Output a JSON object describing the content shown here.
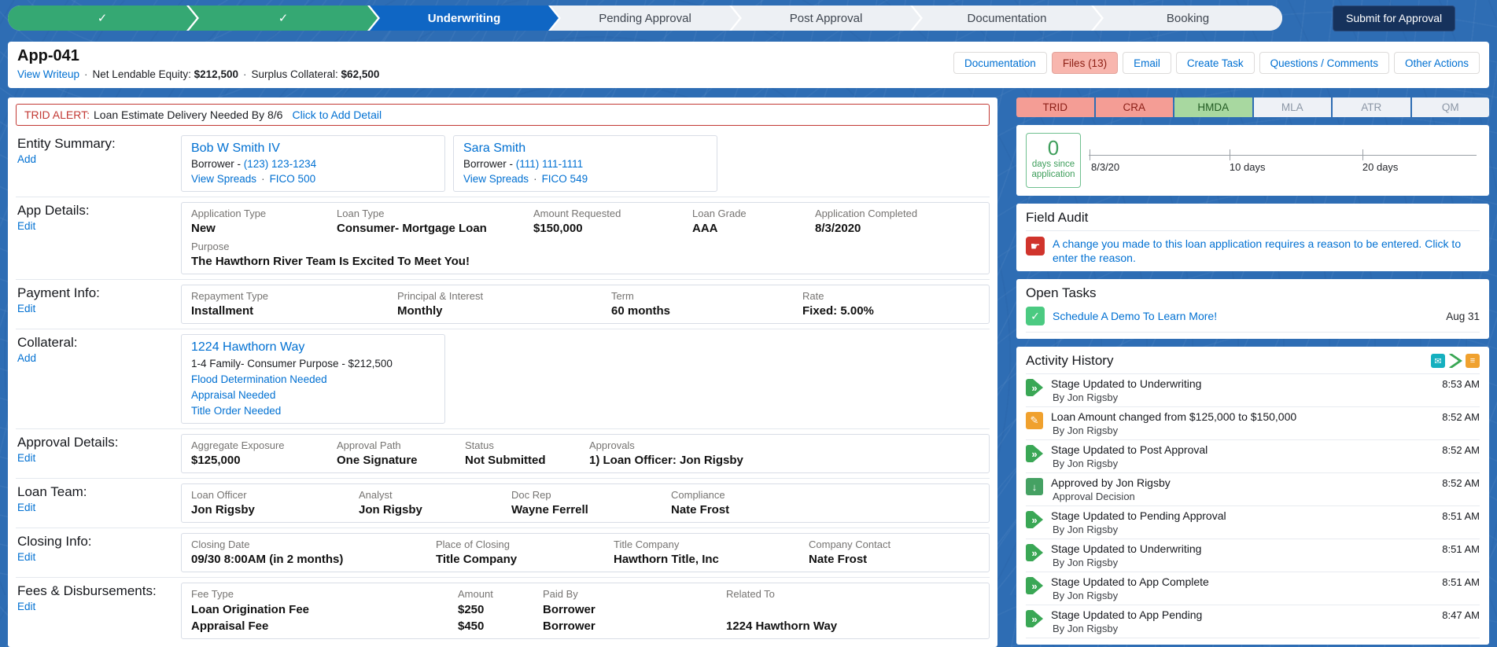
{
  "misc": {
    "dot": "·"
  },
  "icons": {
    "check": "✓",
    "chevrons": "»",
    "mail": "✉",
    "edit": "✎",
    "approve": "↓",
    "list": "≡",
    "hand": "☛",
    "task": "✓"
  },
  "path": {
    "stages": [
      {
        "label": "",
        "state": "complete"
      },
      {
        "label": "",
        "state": "complete"
      },
      {
        "label": "Underwriting",
        "state": "current"
      },
      {
        "label": "Pending Approval",
        "state": "incomplete"
      },
      {
        "label": "Post Approval",
        "state": "incomplete"
      },
      {
        "label": "Documentation",
        "state": "incomplete"
      },
      {
        "label": "Booking",
        "state": "incomplete"
      }
    ],
    "submit_button": "Submit for Approval"
  },
  "header": {
    "title": "App-041",
    "view_writeup": "View Writeup",
    "net_lendable_label": "Net Lendable Equity:",
    "net_lendable_value": "$212,500",
    "surplus_label": "Surplus Collateral:",
    "surplus_value": "$62,500",
    "actions": [
      {
        "label": "Documentation",
        "highlight": false
      },
      {
        "label": "Files (13)",
        "highlight": true
      },
      {
        "label": "Email",
        "highlight": false
      },
      {
        "label": "Create Task",
        "highlight": false
      },
      {
        "label": "Questions / Comments",
        "highlight": false
      },
      {
        "label": "Other Actions",
        "highlight": false
      }
    ]
  },
  "alert": {
    "tag": "TRID ALERT:",
    "message": "Loan Estimate Delivery Needed By 8/6",
    "action": "Click to Add Detail"
  },
  "sections": {
    "entity": {
      "title": "Entity Summary:",
      "action": "Add",
      "borrowers": [
        {
          "name": "Bob W Smith IV",
          "role": "Borrower -",
          "phone": "(123) 123-1234",
          "link1": "View Spreads",
          "link2": "FICO 500"
        },
        {
          "name": "Sara Smith",
          "role": "Borrower -",
          "phone": "(111) 111-1111",
          "link1": "View Spreads",
          "link2": "FICO 549"
        }
      ]
    },
    "app_details": {
      "title": "App Details:",
      "action": "Edit",
      "fields": [
        {
          "label": "Application Type",
          "value": "New"
        },
        {
          "label": "Loan Type",
          "value": "Consumer- Mortgage Loan"
        },
        {
          "label": "Amount Requested",
          "value": "$150,000"
        },
        {
          "label": "Loan Grade",
          "value": "AAA"
        },
        {
          "label": "Application Completed",
          "value": "8/3/2020"
        }
      ],
      "purpose": {
        "label": "Purpose",
        "value": "The Hawthorn River Team Is Excited To Meet You!"
      }
    },
    "payment": {
      "title": "Payment Info:",
      "action": "Edit",
      "fields": [
        {
          "label": "Repayment Type",
          "value": "Installment"
        },
        {
          "label": "Principal & Interest",
          "value": "Monthly"
        },
        {
          "label": "Term",
          "value": "60 months"
        },
        {
          "label": "Rate",
          "value": "Fixed: 5.00%"
        }
      ]
    },
    "collateral": {
      "title": "Collateral:",
      "action": "Add",
      "address": "1224 Hawthorn Way",
      "description": "1-4 Family- Consumer Purpose - $212,500",
      "links": [
        "Flood Determination Needed",
        "Appraisal Needed",
        "Title Order Needed"
      ]
    },
    "approval": {
      "title": "Approval Details:",
      "action": "Edit",
      "fields": [
        {
          "label": "Aggregate Exposure",
          "value": "$125,000"
        },
        {
          "label": "Approval Path",
          "value": "One Signature"
        },
        {
          "label": "Status",
          "value": "Not Submitted"
        },
        {
          "label": "Approvals",
          "value": "1) Loan Officer: Jon Rigsby"
        }
      ]
    },
    "loan_team": {
      "title": "Loan Team:",
      "action": "Edit",
      "fields": [
        {
          "label": "Loan Officer",
          "value": "Jon Rigsby"
        },
        {
          "label": "Analyst",
          "value": "Jon Rigsby"
        },
        {
          "label": "Doc Rep",
          "value": "Wayne Ferrell"
        },
        {
          "label": "Compliance",
          "value": "Nate Frost"
        }
      ]
    },
    "closing": {
      "title": "Closing Info:",
      "action": "Edit",
      "fields": [
        {
          "label": "Closing Date",
          "value": "09/30 8:00AM (in 2 months)"
        },
        {
          "label": "Place of Closing",
          "value": "Title Company"
        },
        {
          "label": "Title Company",
          "value": "Hawthorn Title, Inc"
        },
        {
          "label": "Company Contact",
          "value": "Nate Frost"
        }
      ]
    },
    "fees": {
      "title": "Fees & Disbursements:",
      "action": "Edit",
      "headers": [
        "Fee Type",
        "Amount",
        "Paid By",
        "Related To"
      ],
      "rows": [
        {
          "fee": "Loan Origination Fee",
          "amount": "$250",
          "paid_by": "Borrower",
          "related": ""
        },
        {
          "fee": "Appraisal Fee",
          "amount": "$450",
          "paid_by": "Borrower",
          "related": "1224 Hawthorn Way"
        }
      ]
    }
  },
  "compliance_tabs": [
    {
      "label": "TRID",
      "state": "red"
    },
    {
      "label": "CRA",
      "state": "red"
    },
    {
      "label": "HMDA",
      "state": "green"
    },
    {
      "label": "MLA",
      "state": "off"
    },
    {
      "label": "ATR",
      "state": "off"
    },
    {
      "label": "QM",
      "state": "off"
    }
  ],
  "timeline": {
    "days_number": "0",
    "days_caption": "days since application",
    "start_label": "8/3/20",
    "mid_label": "10 days",
    "end_label": "20 days"
  },
  "field_audit": {
    "title": "Field Audit",
    "message": "A change you made to this loan application requires a reason to be entered. Click to enter the reason."
  },
  "open_tasks": {
    "title": "Open Tasks",
    "task": "Schedule A Demo To Learn More!",
    "due": "Aug 31"
  },
  "activity": {
    "title": "Activity History",
    "items": [
      {
        "icon": "stage-icon",
        "line1": "Stage Updated to Underwriting",
        "line2": "By Jon Rigsby",
        "time": "8:53 AM"
      },
      {
        "icon": "edit-icon",
        "line1": "Loan Amount changed from $125,000 to $150,000",
        "line2": "By Jon Rigsby",
        "time": "8:52 AM"
      },
      {
        "icon": "stage-icon",
        "line1": "Stage Updated to Post Approval",
        "line2": "By Jon Rigsby",
        "time": "8:52 AM"
      },
      {
        "icon": "approve-icon",
        "line1": "Approved by Jon Rigsby",
        "line2": "Approval Decision",
        "time": "8:52 AM"
      },
      {
        "icon": "stage-icon",
        "line1": "Stage Updated to Pending Approval",
        "line2": "By Jon Rigsby",
        "time": "8:51 AM"
      },
      {
        "icon": "stage-icon",
        "line1": "Stage Updated to Underwriting",
        "line2": "By Jon Rigsby",
        "time": "8:51 AM"
      },
      {
        "icon": "stage-icon",
        "line1": "Stage Updated to App Complete",
        "line2": "By Jon Rigsby",
        "time": "8:51 AM"
      },
      {
        "icon": "stage-icon",
        "line1": "Stage Updated to App Pending",
        "line2": "By Jon Rigsby",
        "time": "8:47 AM"
      }
    ]
  }
}
